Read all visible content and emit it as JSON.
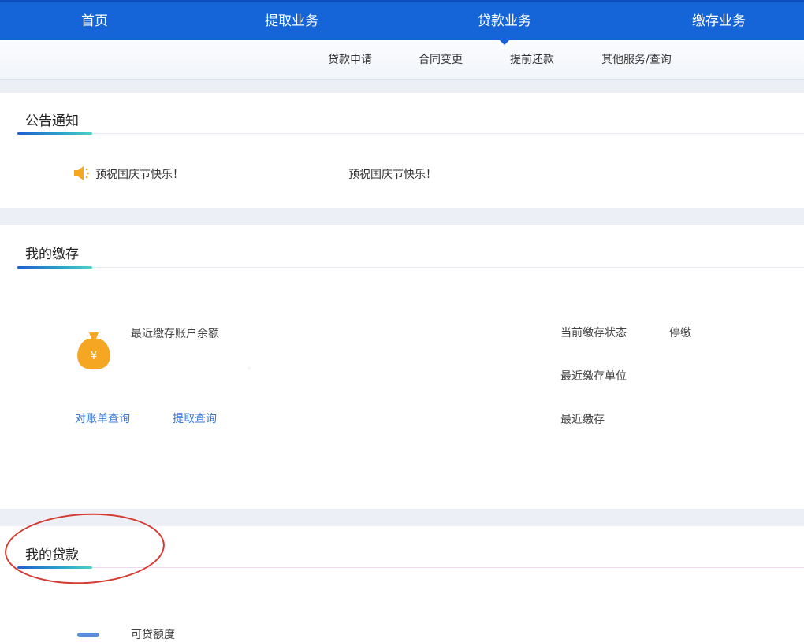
{
  "nav": {
    "home": "首页",
    "withdraw": "提取业务",
    "loan": "贷款业务",
    "deposit": "缴存业务"
  },
  "subnav": {
    "apply": "贷款申请",
    "contract": "合同变更",
    "prepay": "提前还款",
    "other": "其他服务/查询"
  },
  "notice": {
    "title": "公告通知",
    "item1": "预祝国庆节快乐！",
    "item2": "预祝国庆节快乐！"
  },
  "deposit": {
    "title": "我的缴存",
    "balance_label": "最近缴存账户余额",
    "status_label": "当前缴存状态",
    "status_value": "停缴",
    "unit_label": "最近缴存单位",
    "latest_label": "最近缴存",
    "link_statement": "对账单查询",
    "link_withdraw": "提取查询"
  },
  "loan": {
    "title": "我的贷款",
    "quota_label": "可贷额度"
  },
  "colors": {
    "primary": "#1565d8",
    "link": "#3b78d8",
    "annotation": "#d43a2f",
    "icon_orange": "#f5a623"
  }
}
